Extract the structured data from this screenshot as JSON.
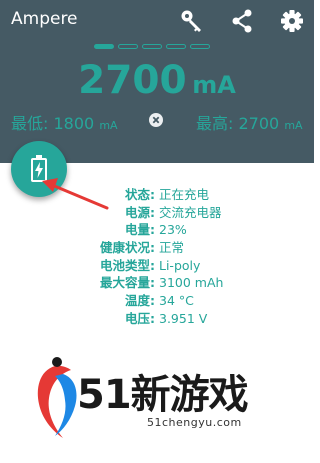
{
  "app": {
    "title": "Ampere"
  },
  "toolbar": {
    "icons": [
      "key-icon",
      "share-icon",
      "settings-gear-icon"
    ]
  },
  "pager": {
    "count": 5,
    "active_index": 0
  },
  "current": {
    "value": "2700",
    "unit": "mA"
  },
  "min": {
    "label": "最低:",
    "value": "1800",
    "unit": "mA"
  },
  "max": {
    "label": "最高:",
    "value": "2700",
    "unit": "mA"
  },
  "fab": {
    "icon": "battery-charging-icon"
  },
  "battery_info": [
    {
      "label": "状态:",
      "value": "正在充电"
    },
    {
      "label": "电源:",
      "value": "交流充电器"
    },
    {
      "label": "电量:",
      "value": "23%"
    },
    {
      "label": "健康状况:",
      "value": "正常"
    },
    {
      "label": "电池类型:",
      "value": "Li-poly"
    },
    {
      "label": "最大容量:",
      "value": "3100 mAh"
    },
    {
      "label": "温度:",
      "value": "34 °C"
    },
    {
      "label": "电压:",
      "value": "3.951 V"
    }
  ],
  "watermark": {
    "brand": "51新游戏",
    "url": "51chengyu.com"
  },
  "colors": {
    "appbar": "#455a64",
    "accent": "#26a69a",
    "arrow": "#e53935"
  }
}
